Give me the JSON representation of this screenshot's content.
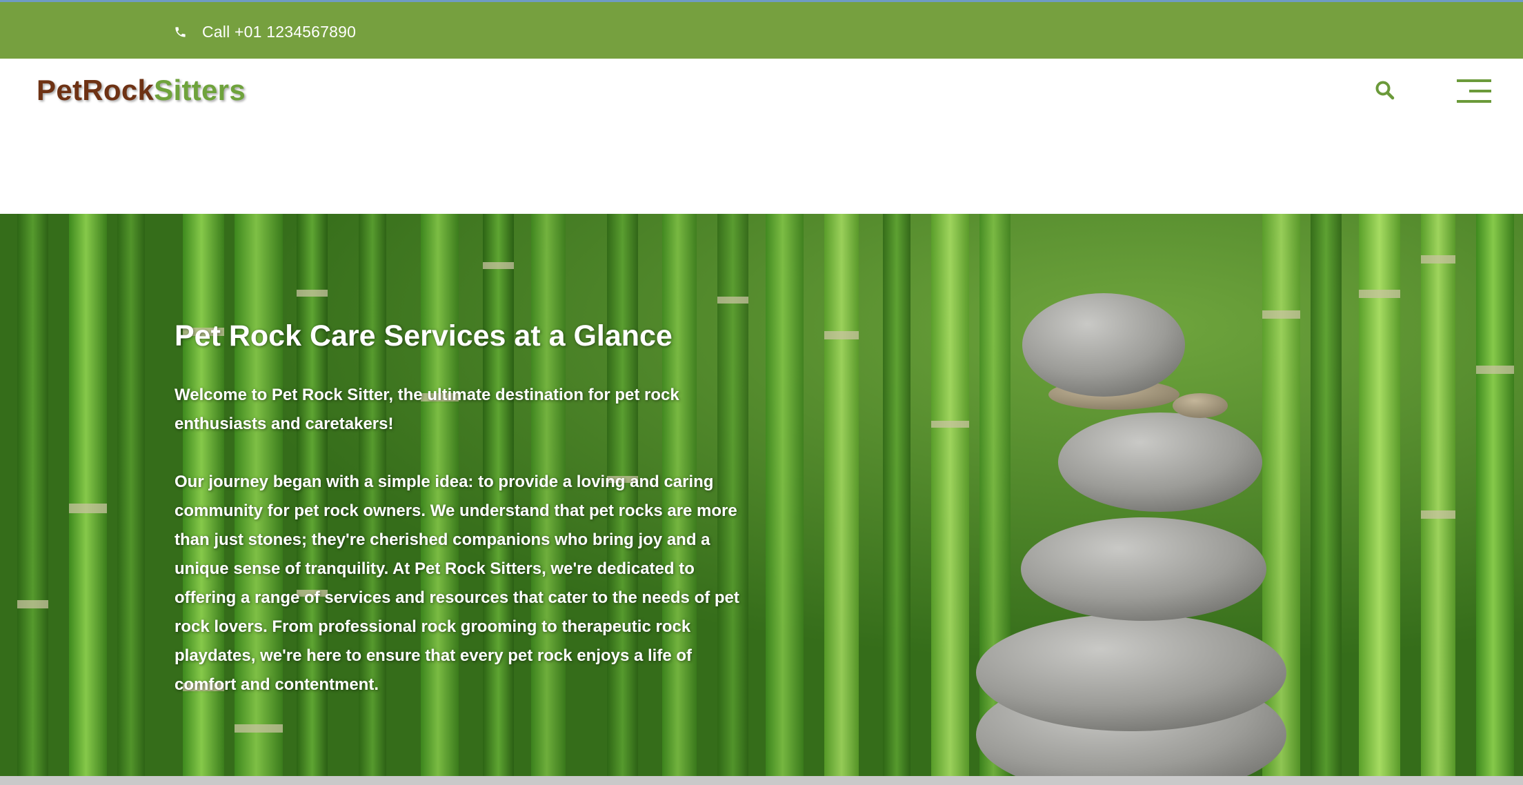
{
  "topbar": {
    "phone_icon": "phone-icon",
    "phone_text": "Call +01 1234567890",
    "bg_color": "#76a03f"
  },
  "header": {
    "logo_part1": "PetRock",
    "logo_part2": "Sitters",
    "logo_color1": "#6e3214",
    "logo_color2": "#6fa33c",
    "search_icon": "search-icon",
    "menu_icon": "hamburger-menu-icon"
  },
  "hero": {
    "title": "Pet Rock Care Services at a Glance",
    "paragraph1": "Welcome to Pet Rock Sitter, the ultimate destination for pet rock enthusiasts and caretakers!",
    "paragraph2": "Our journey began with a simple idea: to provide a loving and caring community for pet rock owners. We understand that pet rocks are more than just stones; they're cherished companions who bring joy and a unique sense of tranquility. At Pet Rock Sitters, we're dedicated to offering a range of services and resources that cater to the needs of pet rock lovers. From professional rock grooming to therapeutic rock playdates, we're here to ensure that every pet rock enjoys a life of comfort and contentment.",
    "image": "bamboo-background-with-stacked-stones"
  }
}
